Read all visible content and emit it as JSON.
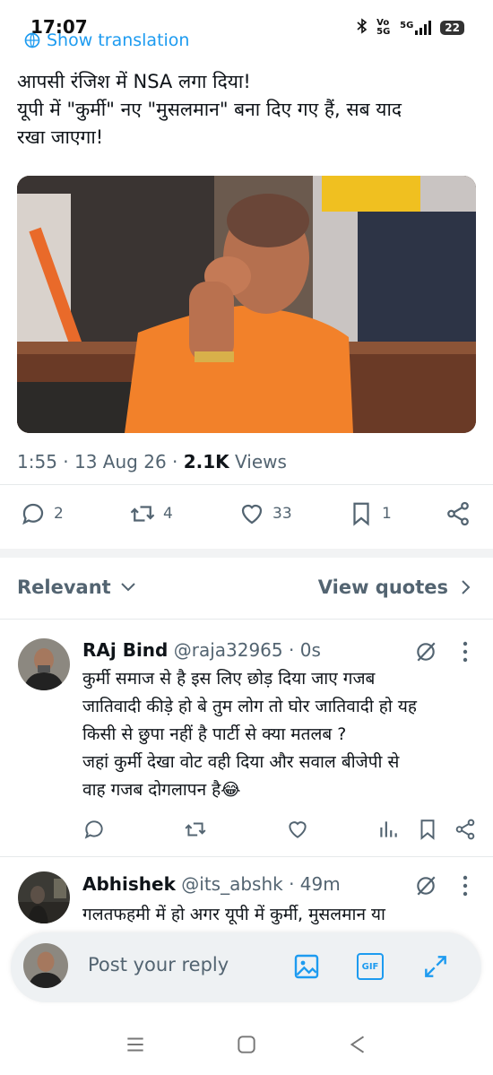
{
  "status_bar": {
    "time": "17:07",
    "network": "5G",
    "volte": "Vo 5G",
    "battery": "22"
  },
  "tweet": {
    "show_translation": "Show translation",
    "text_lines": [
      "आपसी रंजिश में NSA लगा दिया!",
      "यूपी में  \"कुर्मी\" नए \"मुसलमान\" बना दिए गए हैं, सब याद",
      "रखा जाएगा!"
    ],
    "time": "1:55",
    "date": "13 Aug 26",
    "views_count": "2.1K",
    "views_label": "Views",
    "separator": "·",
    "replies": "2",
    "reposts": "4",
    "likes": "33",
    "bookmarks": "1"
  },
  "filter": {
    "label": "Relevant",
    "view_quotes": "View quotes"
  },
  "replies": [
    {
      "name": "RAj Bind",
      "handle": "@raja32965",
      "time": "0s",
      "lines": [
        "कुर्मी समाज से है इस लिए छोड़ दिया जाए गजब",
        "जातिवादी कीड़े हो बे तुम लोग तो घोर जातिवादी हो यह",
        "किसी से छुपा नहीं है पार्टी से क्या मतलब ?",
        "जहां कुर्मी देखा वोट वही दिया और सवाल बीजेपी से",
        "वाह गजब दोगलापन है😂"
      ]
    },
    {
      "name": "Abhishek",
      "handle": "@its_abshk",
      "time": "49m",
      "lines": [
        "गलतफहमी में हो अगर यूपी में कुर्मी, मुसलमान या"
      ]
    }
  ],
  "composer": {
    "placeholder": "Post your reply",
    "gif_label": "GIF"
  },
  "colors": {
    "accent": "#1d9bf0",
    "text": "#0f1419",
    "muted": "#536471"
  }
}
